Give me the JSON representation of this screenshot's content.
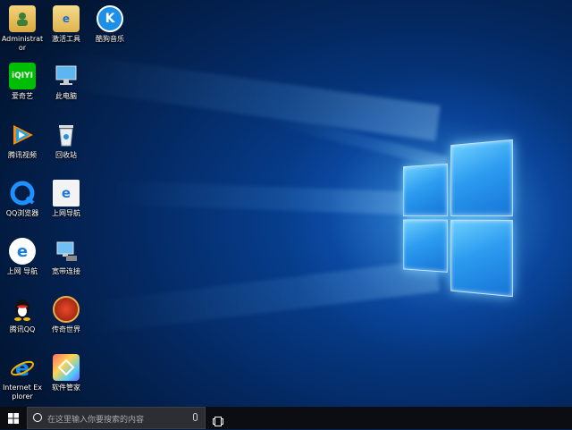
{
  "desktop": {
    "icons": [
      {
        "label": "Administrator",
        "icon": "user-folder-icon"
      },
      {
        "label": "激活工具",
        "icon": "folder-icon"
      },
      {
        "label": "酷狗音乐",
        "icon": "kugou-music-icon"
      },
      {
        "label": "爱奇艺",
        "icon": "iqiyi-icon"
      },
      {
        "label": "此电脑",
        "icon": "computer-icon"
      },
      {
        "label": "腾讯视频",
        "icon": "tencent-video-icon"
      },
      {
        "label": "回收站",
        "icon": "recycle-bin-icon"
      },
      {
        "label": "QQ浏览器",
        "icon": "qq-browser-icon"
      },
      {
        "label": "上网导航",
        "icon": "web-nav-icon"
      },
      {
        "label": "上网 导航",
        "icon": "ie-nav-icon"
      },
      {
        "label": "宽带连接",
        "icon": "broadband-icon"
      },
      {
        "label": "腾讯QQ",
        "icon": "qq-penguin-icon"
      },
      {
        "label": "传奇世界",
        "icon": "legend-world-icon"
      },
      {
        "label": "Internet Explorer",
        "icon": "internet-explorer-icon"
      },
      {
        "label": "软件管家",
        "icon": "software-manager-icon"
      }
    ],
    "wallpaper": "windows-10-hero",
    "accent": "#1e7fe0"
  },
  "taskbar": {
    "search_placeholder": "在这里输入你要搜索的内容",
    "background": "#0b0d12"
  }
}
